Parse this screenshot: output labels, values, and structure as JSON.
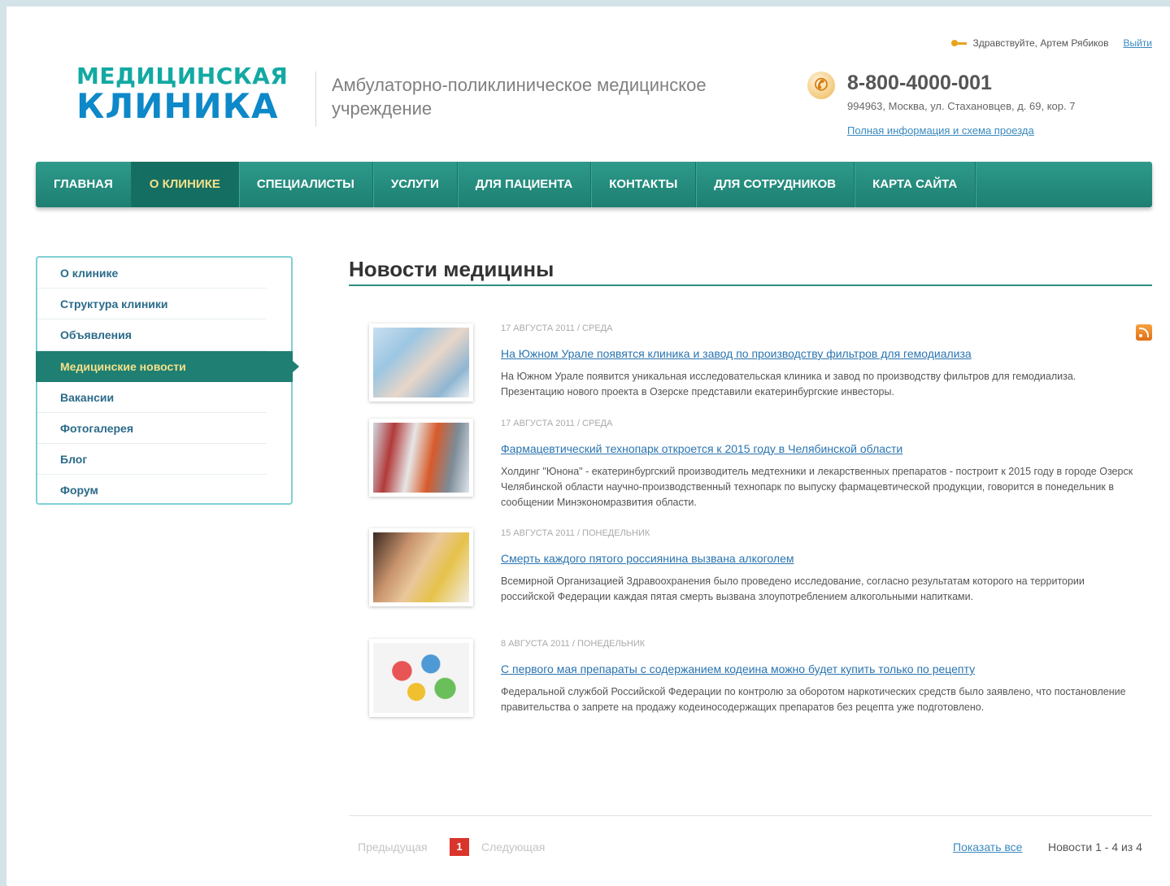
{
  "header": {
    "greeting": "Здравствуйте, Артем Рябиков",
    "logout": "Выйти",
    "logo_top": "МЕДИЦИНСКАЯ",
    "logo_bottom": "КЛИНИКА",
    "tagline": "Амбулаторно-поликлиническое медицинское учреждение",
    "phone": "8-800-4000-001",
    "address": "994963, Москва, ул. Стахановцев, д. 69, кор. 7",
    "full_info_link": "Полная информация и схема проезда"
  },
  "nav": {
    "items": [
      {
        "label": "Главная"
      },
      {
        "label": "О клинике"
      },
      {
        "label": "Специалисты"
      },
      {
        "label": "Услуги"
      },
      {
        "label": "Для пациента"
      },
      {
        "label": "Контакты"
      },
      {
        "label": "Для сотрудников"
      },
      {
        "label": "Карта сайта"
      }
    ],
    "active": "О клинике"
  },
  "sidebar": {
    "items": [
      {
        "label": "О клинике"
      },
      {
        "label": "Структура клиники"
      },
      {
        "label": "Объявления"
      },
      {
        "label": "Медицинские новости"
      },
      {
        "label": "Вакансии"
      },
      {
        "label": "Фотогалерея"
      },
      {
        "label": "Блог"
      },
      {
        "label": "Форум"
      }
    ],
    "active": "Медицинские новости"
  },
  "main": {
    "title": "Новости медицины",
    "news": [
      {
        "date": "17 августа 2011 / среда",
        "title": "На Южном Урале появятся клиника и завод по производству фильтров для гемодиализа",
        "text": "На Южном Урале появится уникальная исследовательская клиника и завод по производству фильтров для гемодиализа. Презентацию нового проекта в Озерске представили екатеринбургские инвесторы."
      },
      {
        "date": "17 августа 2011 / среда",
        "title": "Фармацевтический технопарк откроется к 2015 году в Челябинской области",
        "text": "Холдинг \"Юнона\" - екатеринбургский производитель медтехники и лекарственных препаратов - построит к 2015 году в городе Озерск Челябинской области научно-производственный технопарк по выпуску фармацевтической продукции, говорится в понедельник в сообщении Минэкономразвития области."
      },
      {
        "date": "15 августа 2011 / понедельник",
        "title": "Смерть каждого пятого россиянина вызвана алкоголем",
        "text": "Всемирной Организацией Здравоохранения было проведено исследование, согласно результатам которого на территории российской Федерации каждая пятая смерть вызвана злоупотреблением алкогольными напитками."
      },
      {
        "date": "8 августа 2011 / понедельник",
        "title": "С первого мая препараты с содержанием кодеина можно будет купить только по рецепту",
        "text": "Федеральной службой Российской Федерации по контролю за оборотом наркотических средств было заявлено, что постановление правительства о запрете на продажу кодеиносодержащих препаратов без рецепта уже подготовлено."
      }
    ]
  },
  "pager": {
    "prev": "Предыдущая",
    "current": "1",
    "next": "Следующая",
    "show_all": "Показать все",
    "count": "Новости 1 - 4 из 4"
  }
}
